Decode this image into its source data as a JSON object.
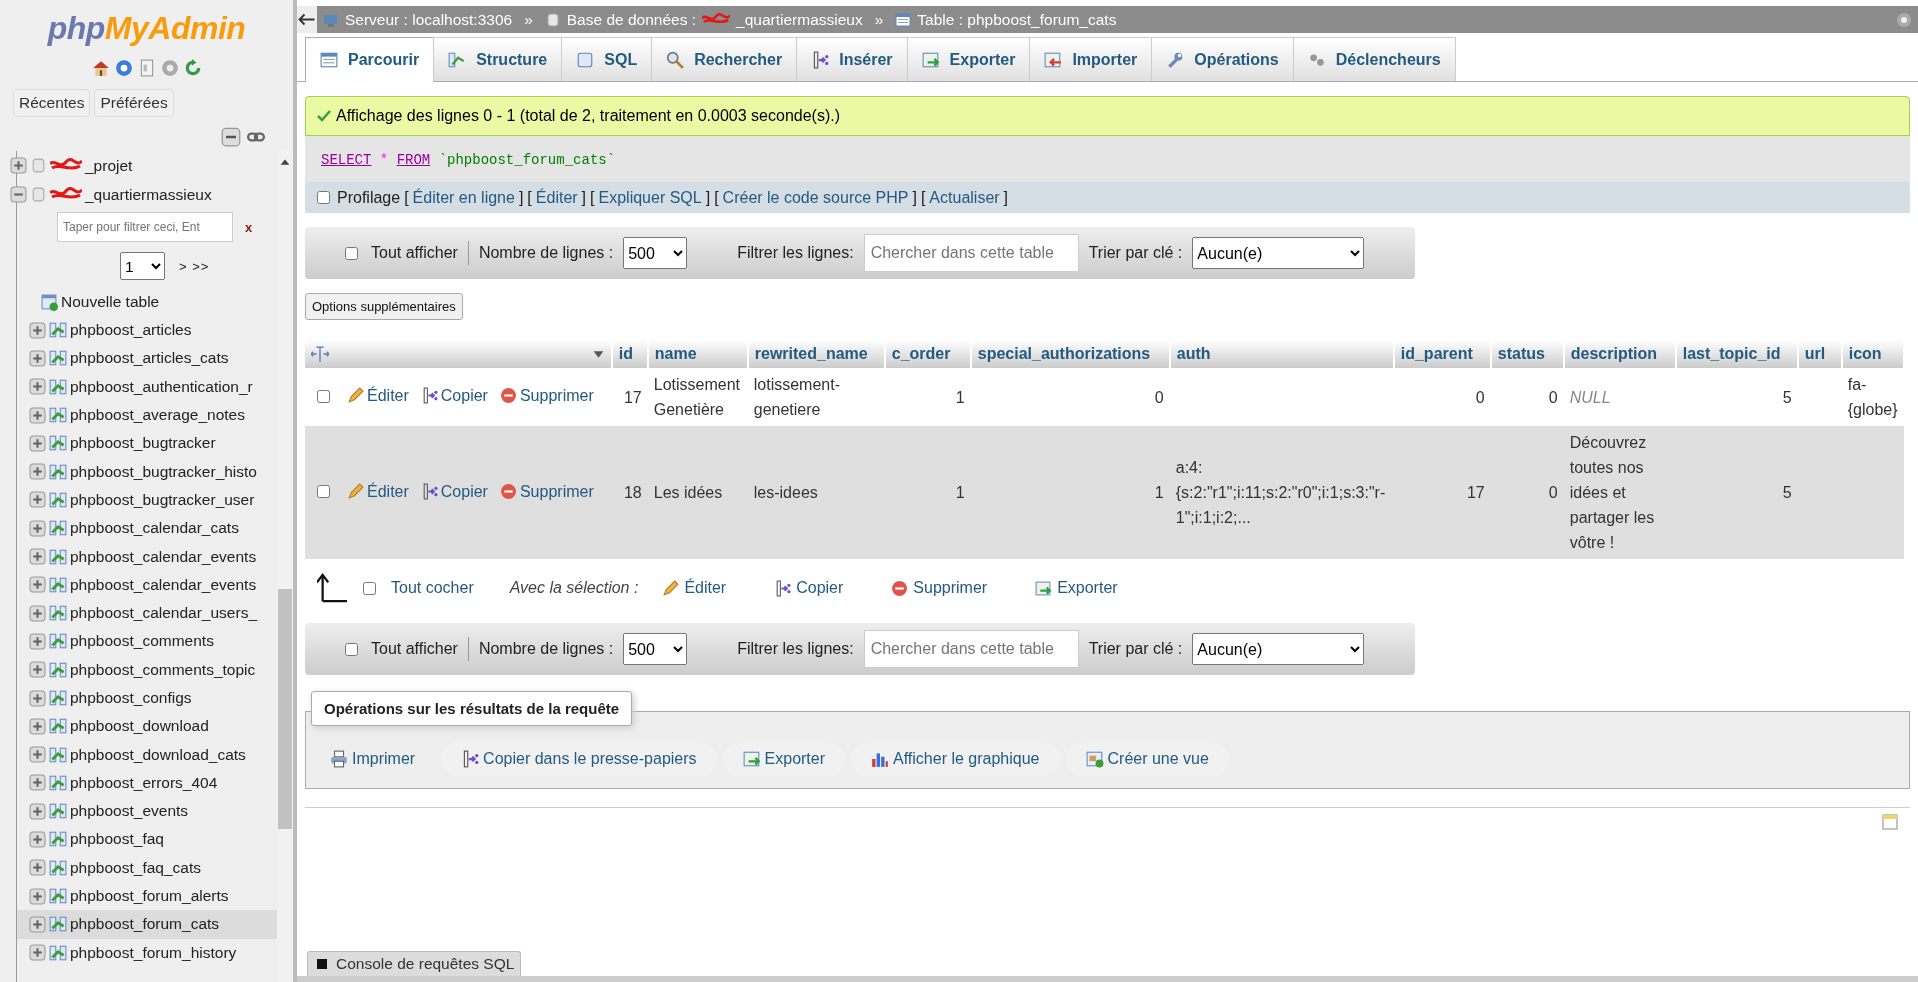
{
  "sidebar": {
    "logo": [
      "php",
      "MyAdmin"
    ],
    "buttons": [
      "Récentes",
      "Préférées"
    ],
    "databases": [
      {
        "name": "_projet",
        "redacted": true,
        "expanded": false
      },
      {
        "name": "_quartiermassieux",
        "redacted": true,
        "expanded": true
      }
    ],
    "filter": {
      "placeholder": "Taper pour filtrer ceci, Ent",
      "clear": "x"
    },
    "page": "1",
    "page_nav": "> >>",
    "new_table": "Nouvelle table",
    "tables": [
      {
        "name": "phpboost_articles",
        "selected": false
      },
      {
        "name": "phpboost_articles_cats",
        "selected": false
      },
      {
        "name": "phpboost_authentication_r",
        "selected": false
      },
      {
        "name": "phpboost_average_notes",
        "selected": false
      },
      {
        "name": "phpboost_bugtracker",
        "selected": false
      },
      {
        "name": "phpboost_bugtracker_histo",
        "selected": false
      },
      {
        "name": "phpboost_bugtracker_user",
        "selected": false
      },
      {
        "name": "phpboost_calendar_cats",
        "selected": false
      },
      {
        "name": "phpboost_calendar_events",
        "selected": false
      },
      {
        "name": "phpboost_calendar_events",
        "selected": false
      },
      {
        "name": "phpboost_calendar_users_",
        "selected": false
      },
      {
        "name": "phpboost_comments",
        "selected": false
      },
      {
        "name": "phpboost_comments_topic",
        "selected": false
      },
      {
        "name": "phpboost_configs",
        "selected": false
      },
      {
        "name": "phpboost_download",
        "selected": false
      },
      {
        "name": "phpboost_download_cats",
        "selected": false
      },
      {
        "name": "phpboost_errors_404",
        "selected": false
      },
      {
        "name": "phpboost_events",
        "selected": false
      },
      {
        "name": "phpboost_faq",
        "selected": false
      },
      {
        "name": "phpboost_faq_cats",
        "selected": false
      },
      {
        "name": "phpboost_forum_alerts",
        "selected": false
      },
      {
        "name": "phpboost_forum_cats",
        "selected": true
      },
      {
        "name": "phpboost_forum_history",
        "selected": false
      }
    ]
  },
  "breadcrumb": [
    {
      "kind": "server",
      "label": "Serveur : localhost:3306"
    },
    {
      "kind": "database",
      "sep": "»",
      "label": "Base de données :",
      "value": "_quartiermassieux",
      "redacted": true
    },
    {
      "kind": "table",
      "sep": "»",
      "label": "Table : phpboost_forum_cats"
    }
  ],
  "tabs": [
    {
      "label": "Parcourir",
      "selected": true
    },
    {
      "label": "Structure",
      "selected": false
    },
    {
      "label": "SQL",
      "selected": false
    },
    {
      "label": "Rechercher",
      "selected": false
    },
    {
      "label": "Insérer",
      "selected": false
    },
    {
      "label": "Exporter",
      "selected": false
    },
    {
      "label": "Importer",
      "selected": false
    },
    {
      "label": "Opérations",
      "selected": false
    },
    {
      "label": "Déclencheurs",
      "selected": false
    }
  ],
  "message": "Affichage des lignes 0 - 1 (total de 2, traitement en 0.0003 seconde(s).)",
  "sql": [
    {
      "kind": "keyword",
      "text": "SELECT"
    },
    {
      "kind": "operator",
      "text": "*"
    },
    {
      "kind": "keyword",
      "text": "FROM"
    },
    {
      "kind": "name",
      "text": "`phpboost_forum_cats`"
    }
  ],
  "profiling": {
    "label": "Profilage",
    "checked": false,
    "links": [
      {
        "open": "[",
        "text": "Éditer en ligne",
        "close": "]"
      },
      {
        "open": "[",
        "text": "Éditer",
        "close": "]"
      },
      {
        "open": "[",
        "text": "Expliquer SQL",
        "close": "]"
      },
      {
        "open": "[",
        "text": "Créer le code source PHP",
        "close": "]"
      },
      {
        "open": "[",
        "text": "Actualiser",
        "close": "]"
      }
    ]
  },
  "navbars": [
    {
      "show_all": "Tout afficher",
      "checked": false,
      "rows_label": "Nombre de lignes :",
      "rows_value": "500",
      "filter_label": "Filtrer les lignes:",
      "filter_placeholder": "Chercher dans cette table",
      "sort_label": "Trier par clé :",
      "sort_value": "Aucun(e)"
    },
    {
      "show_all": "Tout afficher",
      "checked": false,
      "rows_label": "Nombre de lignes :",
      "rows_value": "500",
      "filter_label": "Filtrer les lignes:",
      "filter_placeholder": "Chercher dans cette table",
      "sort_label": "Trier par clé :",
      "sort_value": "Aucun(e)"
    }
  ],
  "options_button": "Options supplémentaires",
  "table": {
    "columns": [
      "id",
      "name",
      "rewrited_name",
      "c_order",
      "special_authorizations",
      "auth",
      "id_parent",
      "status",
      "description",
      "last_topic_id",
      "url",
      "icon"
    ],
    "rows": [
      {
        "checked": false,
        "actions": [
          "Éditer",
          "Copier",
          "Supprimer"
        ],
        "cells": [
          "17",
          "Lotissement Genetière",
          "lotissement-genetiere",
          "1",
          "0",
          null,
          "0",
          "0",
          {
            "kind": "null",
            "text": "NULL"
          },
          "5",
          null,
          "fa-{globe}"
        ]
      },
      {
        "checked": false,
        "actions": [
          "Éditer",
          "Copier",
          "Supprimer"
        ],
        "cells": [
          "18",
          "Les idées",
          "les-idees",
          "1",
          "1",
          "a:4:{s:2:\"r1\";i:11;s:2:\"r0\";i:1;s:3:\"r-1\";i:1;i:2;...",
          "17",
          "0",
          "Découvrez toutes nos idées et partager les vôtre !",
          "5",
          null,
          null
        ]
      }
    ]
  },
  "bulk": {
    "check_all": "Tout cocher",
    "checked": false,
    "with_selection": "Avec la sélection :",
    "actions": [
      "Éditer",
      "Copier",
      "Supprimer",
      "Exporter"
    ]
  },
  "operations": {
    "legend": "Opérations sur les résultats de la requête",
    "buttons": [
      "Imprimer",
      "Copier dans le presse-papiers",
      "Exporter",
      "Afficher le graphique",
      "Créer une vue"
    ]
  },
  "console": "Console de requêtes SQL"
}
